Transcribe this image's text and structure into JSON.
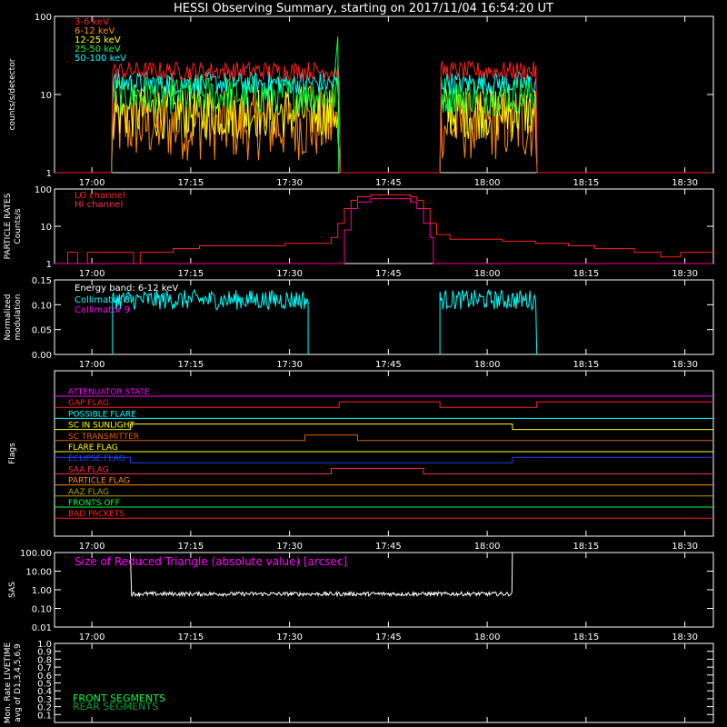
{
  "title": "HESSI Observing Summary, starting on 2017/11/04 16:54:20 UT",
  "colors": {
    "bg": "#000000",
    "axis": "#ffffff",
    "red": "#ff2020",
    "orange": "#ff8c00",
    "yellow": "#ffff00",
    "green": "#00ff40",
    "cyan": "#00ffff",
    "magenta": "#ff00ff",
    "blue": "#2040ff",
    "olive": "#b0a000",
    "darkorange": "#e06000",
    "crimson": "#ff3050",
    "purple": "#c000c0"
  },
  "time_axis": {
    "tmin_min": 0,
    "tmax_min": 100,
    "start_label": "16:54:20",
    "ticks": [
      {
        "t": 5.67,
        "label": "17:00"
      },
      {
        "t": 20.67,
        "label": "17:15"
      },
      {
        "t": 35.67,
        "label": "17:30"
      },
      {
        "t": 50.67,
        "label": "17:45"
      },
      {
        "t": 65.67,
        "label": "18:00"
      },
      {
        "t": 80.67,
        "label": "18:15"
      },
      {
        "t": 95.67,
        "label": "18:30"
      }
    ]
  },
  "chart_data": [
    {
      "id": "counts",
      "type": "line",
      "ylabel": "counts/s/detector",
      "yscale": "log",
      "ylim": [
        1,
        100
      ],
      "yticks": [
        {
          "v": 1,
          "label": "1"
        },
        {
          "v": 10,
          "label": "10"
        },
        {
          "v": 100,
          "label": "100"
        }
      ],
      "series": [
        {
          "name": "3-6 keV",
          "color": "#ff2020",
          "segments": [
            [
              8.8,
              43.2,
              20
            ],
            [
              58.5,
              73.2,
              20
            ]
          ],
          "noise": 0.12,
          "background": 1
        },
        {
          "name": "6-12 keV",
          "color": "#ff8c00",
          "segments": [
            [
              8.8,
              43.2,
              4
            ],
            [
              58.5,
              73.2,
              4
            ]
          ],
          "noise": 0.45,
          "background": 1
        },
        {
          "name": "12-25 keV",
          "color": "#ffff00",
          "segments": [
            [
              8.8,
              43.2,
              6
            ],
            [
              58.5,
              73.2,
              6
            ]
          ],
          "noise": 0.35,
          "background": 1
        },
        {
          "name": "25-50 keV",
          "color": "#00ff40",
          "segments": [
            [
              8.8,
              43.2,
              10
            ],
            [
              58.5,
              73.2,
              10
            ]
          ],
          "noise": 0.25,
          "background": 1
        },
        {
          "name": "50-100 keV",
          "color": "#00ffff",
          "segments": [
            [
              8.8,
              43.2,
              14
            ],
            [
              58.5,
              73.2,
              14
            ]
          ],
          "noise": 0.15,
          "background": 1
        }
      ]
    },
    {
      "id": "particle",
      "type": "line",
      "ylabel": "PARTICLE RATES Counts/s",
      "yscale": "log",
      "ylim": [
        1,
        100
      ],
      "yticks": [
        {
          "v": 1,
          "label": "1"
        },
        {
          "v": 10,
          "label": "10"
        },
        {
          "v": 100,
          "label": "100"
        }
      ],
      "series": [
        {
          "name": "LO channel",
          "color": "#ff2020"
        },
        {
          "name": "HI channel",
          "color": "#ff3050"
        }
      ],
      "lo_steps": [
        [
          0,
          1.0
        ],
        [
          2,
          2.0
        ],
        [
          3.5,
          1.0
        ],
        [
          5,
          2.0
        ],
        [
          12,
          1.0
        ],
        [
          13,
          2.0
        ],
        [
          18,
          2.5
        ],
        [
          22,
          3.0
        ],
        [
          35,
          3.5
        ],
        [
          42,
          5
        ],
        [
          43,
          12
        ],
        [
          44,
          30
        ],
        [
          45,
          50
        ],
        [
          46,
          62
        ],
        [
          48,
          70
        ],
        [
          52,
          70
        ],
        [
          54,
          62
        ],
        [
          55,
          50
        ],
        [
          56,
          30
        ],
        [
          57,
          12
        ],
        [
          58,
          6
        ],
        [
          60,
          4.5
        ],
        [
          68,
          4
        ],
        [
          73,
          3.5
        ],
        [
          78,
          3
        ],
        [
          82,
          2.5
        ],
        [
          88,
          2
        ],
        [
          92,
          1.5
        ],
        [
          95,
          2
        ],
        [
          100,
          2
        ]
      ],
      "hi_steps": [
        [
          0,
          1.0
        ],
        [
          43,
          1.0
        ],
        [
          44,
          8
        ],
        [
          45,
          30
        ],
        [
          46,
          45
        ],
        [
          48,
          55
        ],
        [
          52,
          55
        ],
        [
          54,
          45
        ],
        [
          55,
          30
        ],
        [
          56,
          12
        ],
        [
          57,
          5
        ],
        [
          57.5,
          1.0
        ],
        [
          100,
          1.0
        ]
      ]
    },
    {
      "id": "modulation",
      "type": "line",
      "ylabel": "Normalized modulation",
      "ylim": [
        0,
        0.15
      ],
      "yticks": [
        {
          "v": 0,
          "label": "0.00"
        },
        {
          "v": 0.05,
          "label": "0.05"
        },
        {
          "v": 0.1,
          "label": "0.10"
        },
        {
          "v": 0.15,
          "label": "0.15"
        }
      ],
      "annotation": "Energy band: 6-12 keV",
      "series": [
        {
          "name": "Collimator 8",
          "color": "#00ffff",
          "segments": [
            [
              8.8,
              38.5,
              0.11
            ],
            [
              58.5,
              73.2,
              0.11
            ]
          ]
        },
        {
          "name": "Collimator 9",
          "color": "#ff00ff",
          "segments": []
        }
      ]
    },
    {
      "id": "flags",
      "type": "line",
      "ylabel": "Flags",
      "flags": [
        {
          "name": "ATTENUATOR STATE",
          "color": "#ff00ff",
          "steps": [
            [
              0,
              0
            ],
            [
              100,
              0
            ]
          ]
        },
        {
          "name": "GAP FLAG",
          "color": "#ff2020",
          "steps": [
            [
              0,
              0
            ],
            [
              43.2,
              1
            ],
            [
              58.5,
              0
            ],
            [
              73.2,
              1
            ]
          ]
        },
        {
          "name": "POSSIBLE FLARE",
          "color": "#00ffff",
          "steps": [
            [
              0,
              0
            ],
            [
              100,
              0
            ]
          ]
        },
        {
          "name": "SC IN SUNLIGHT",
          "color": "#ffff00",
          "steps": [
            [
              0,
              0
            ],
            [
              11.5,
              1
            ],
            [
              69.5,
              0
            ]
          ]
        },
        {
          "name": "SC TRANSMITTER",
          "color": "#e06000",
          "steps": [
            [
              0,
              0
            ],
            [
              38,
              1
            ],
            [
              46,
              0
            ]
          ]
        },
        {
          "name": "FLARE FLAG",
          "color": "#ffff00",
          "steps": [
            [
              0,
              0
            ],
            [
              100,
              0
            ]
          ]
        },
        {
          "name": "ECLIPSE FLAG",
          "color": "#2040ff",
          "steps": [
            [
              0,
              1
            ],
            [
              11.5,
              0
            ],
            [
              69.5,
              1
            ]
          ]
        },
        {
          "name": "SAA FLAG",
          "color": "#ff3050",
          "steps": [
            [
              0,
              0
            ],
            [
              42,
              1
            ],
            [
              56,
              0
            ]
          ]
        },
        {
          "name": "PARTICLE FLAG",
          "color": "#ff8c00",
          "steps": [
            [
              0,
              0
            ],
            [
              100,
              0
            ]
          ]
        },
        {
          "name": "AAZ FLAG",
          "color": "#b0a000",
          "steps": [
            [
              0,
              0
            ],
            [
              100,
              0
            ]
          ]
        },
        {
          "name": "FRONTS OFF",
          "color": "#00ff40",
          "steps": [
            [
              0,
              0
            ],
            [
              100,
              0
            ]
          ]
        },
        {
          "name": "BAD PACKETS",
          "color": "#ff2020",
          "steps": [
            [
              0,
              0
            ],
            [
              100,
              0
            ]
          ]
        }
      ]
    },
    {
      "id": "sas",
      "type": "line",
      "ylabel": "SAS",
      "yscale": "log",
      "ylim": [
        0.01,
        100
      ],
      "yticks": [
        {
          "v": 0.01,
          "label": "0.01"
        },
        {
          "v": 0.1,
          "label": "0.10"
        },
        {
          "v": 1,
          "label": "1.00"
        },
        {
          "v": 10,
          "label": "10.00"
        },
        {
          "v": 100,
          "label": "100.00"
        }
      ],
      "annotation": "Size of Reduced Triangle (absolute value) [arcsec]",
      "series": [
        {
          "name": "SAS",
          "color": "#ffffff",
          "segments": [
            [
              11.5,
              69.5,
              0.6
            ]
          ]
        }
      ]
    },
    {
      "id": "livetime",
      "type": "line",
      "ylabel": "Mon. Rate LIVETIME avg of D1,3,4,5,6,9",
      "ylim": [
        0,
        1.0
      ],
      "yticks": [
        {
          "v": 0.1,
          "label": "0.1"
        },
        {
          "v": 0.2,
          "label": "0.2"
        },
        {
          "v": 0.3,
          "label": "0.3"
        },
        {
          "v": 0.4,
          "label": "0.4"
        },
        {
          "v": 0.5,
          "label": "0.5"
        },
        {
          "v": 0.6,
          "label": "0.6"
        },
        {
          "v": 0.7,
          "label": "0.7"
        },
        {
          "v": 0.8,
          "label": "0.8"
        },
        {
          "v": 0.9,
          "label": "0.9"
        },
        {
          "v": 1.0,
          "label": "1.0"
        }
      ],
      "series": [
        {
          "name": "FRONT SEGMENTS",
          "color": "#00ff40"
        },
        {
          "name": "REAR SEGMENTS",
          "color": "#00a030"
        }
      ]
    }
  ]
}
